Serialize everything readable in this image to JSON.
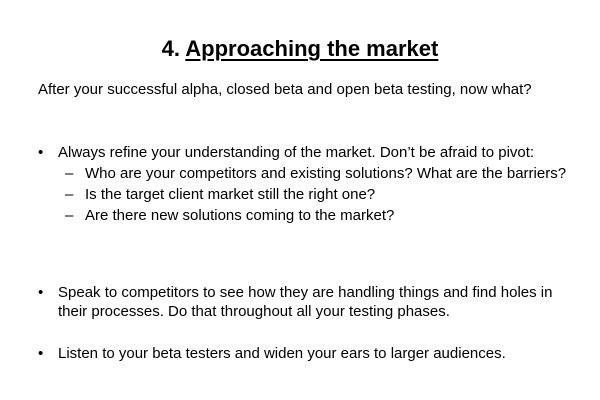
{
  "slide": {
    "title_number": "4.",
    "title_text": "Approaching the market",
    "intro": "After your successful alpha, closed beta and open beta testing, now what?",
    "bullet_glyph": "•",
    "dash_glyph": "–",
    "bullets": [
      {
        "text": "Always refine your understanding of the market. Don’t be afraid to pivot:",
        "subitems": [
          "Who are your competitors and existing solutions? What are the barriers?",
          "Is the target client market still the right one?",
          "Are there new solutions coming to the market?"
        ]
      },
      {
        "text": "Speak to competitors to see how they are handling things and find holes in their processes. Do that throughout all your testing phases."
      },
      {
        "text": "Listen to your beta testers and widen your ears to larger audiences."
      }
    ]
  }
}
